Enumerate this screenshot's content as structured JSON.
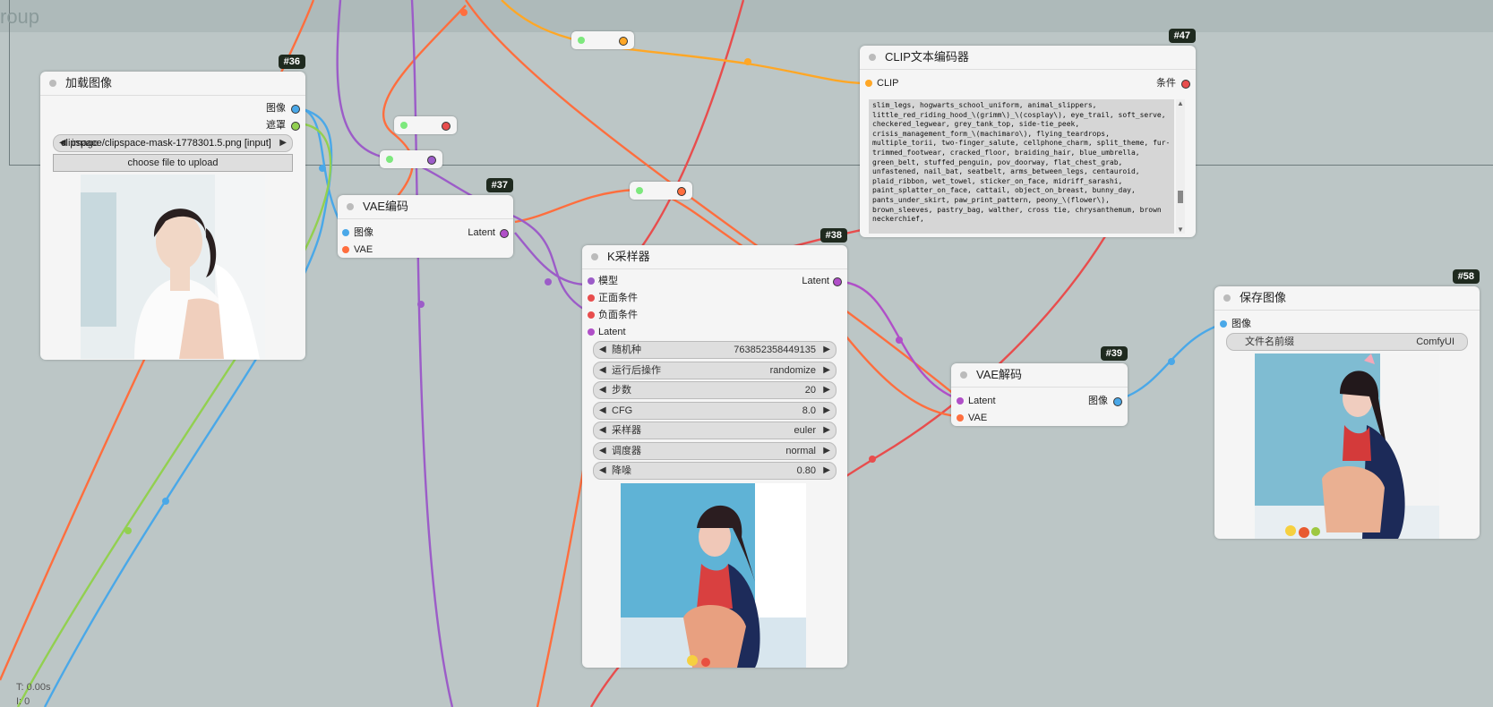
{
  "group": {
    "title": "roup"
  },
  "colors": {
    "image": "#4aa8e8",
    "mask": "#92d050",
    "vae": "#ff6e3e",
    "latent": "#b04fc8",
    "clip": "#ffa726",
    "cond": "#e84d4d",
    "green": "#7de87d",
    "model": "#9c5cc8"
  },
  "nodes": {
    "load_image": {
      "id": "#36",
      "title": "加载图像",
      "out_image": "图像",
      "out_mask": "遮罩",
      "file_value": "clipspace/clipspace-mask-1778301.5.png [input]",
      "file_label": "image",
      "upload": "choose file to upload"
    },
    "vae_encode": {
      "id": "#37",
      "title": "VAE编码",
      "in_image": "图像",
      "in_vae": "VAE",
      "out_latent": "Latent"
    },
    "clip_encode": {
      "id": "#47",
      "title": "CLIP文本编码器",
      "in_clip": "CLIP",
      "out_cond": "条件",
      "text": "slim_legs, hogwarts_school_uniform, animal_slippers, little_red_riding_hood_\\(grimm\\)_\\(cosplay\\), eye_trail, soft_serve, checkered_legwear, grey_tank_top, side-tie_peek, crisis_management_form_\\(machimaro\\), flying_teardrops, multiple_torii, two-finger_salute, cellphone_charm, split_theme, fur-trimmed_footwear, cracked_floor, braiding_hair, blue_umbrella, green_belt, stuffed_penguin, pov_doorway, flat_chest_grab, unfastened, nail_bat, seatbelt, arms_between_legs, centauroid, plaid_ribbon, wet_towel, sticker_on_face, midriff_sarashi, paint_splatter_on_face, cattail, object_on_breast, bunny_day, pants_under_skirt, paw_print_pattern, peony_\\(flower\\), brown_sleeves, pastry_bag, walther, cross tie, chrysanthemum, brown neckerchief,"
    },
    "ksampler": {
      "id": "#38",
      "title": "K采样器",
      "in_model": "模型",
      "in_pos": "正面条件",
      "in_neg": "负面条件",
      "in_latent": "Latent",
      "out_latent": "Latent",
      "widgets": [
        {
          "label": "随机种",
          "value": "763852358449135"
        },
        {
          "label": "运行后操作",
          "value": "randomize"
        },
        {
          "label": "步数",
          "value": "20"
        },
        {
          "label": "CFG",
          "value": "8.0"
        },
        {
          "label": "采样器",
          "value": "euler"
        },
        {
          "label": "调度器",
          "value": "normal"
        },
        {
          "label": "降噪",
          "value": "0.80"
        }
      ]
    },
    "vae_decode": {
      "id": "#39",
      "title": "VAE解码",
      "in_latent": "Latent",
      "in_vae": "VAE",
      "out_image": "图像"
    },
    "save_image": {
      "id": "#58",
      "title": "保存图像",
      "in_image": "图像",
      "prefix_label": "文件名前缀",
      "prefix_value": "ComfyUI"
    }
  },
  "status": {
    "time": "T: 0.00s",
    "line2": "I: 0"
  }
}
